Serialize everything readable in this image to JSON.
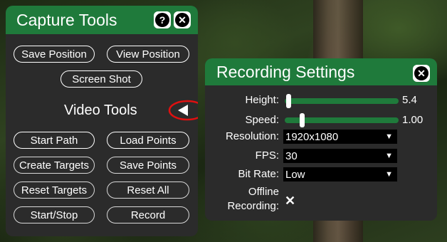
{
  "capture_panel": {
    "title": "Capture Tools",
    "help_glyph": "?",
    "close_glyph": "✕",
    "buttons": {
      "save_position": "Save Position",
      "view_position": "View Position",
      "screen_shot": "Screen Shot",
      "start_path": "Start Path",
      "load_points": "Load Points",
      "create_targets": "Create Targets",
      "save_points": "Save Points",
      "reset_targets": "Reset Targets",
      "reset_all": "Reset All",
      "start_stop": "Start/Stop",
      "record": "Record"
    },
    "video_tools_label": "Video Tools",
    "toggle_glyph": "◀",
    "accent_color": "#1f7a3b",
    "highlight_ring_color": "#e01010"
  },
  "recording_panel": {
    "title": "Recording Settings",
    "close_glyph": "✕",
    "height": {
      "label": "Height:",
      "value": "5.4",
      "level": 0.03
    },
    "speed": {
      "label": "Speed:",
      "value": "1.00",
      "level": 0.15
    },
    "resolution": {
      "label": "Resolution:",
      "value": "1920x1080"
    },
    "fps": {
      "label": "FPS:",
      "value": "30"
    },
    "bit_rate": {
      "label": "Bit Rate:",
      "value": "Low"
    },
    "offline_recording": {
      "label_line1": "Offline",
      "label_line2": "Recording:",
      "checked": true,
      "check_glyph": "✕"
    },
    "caret_glyph": "▼"
  }
}
